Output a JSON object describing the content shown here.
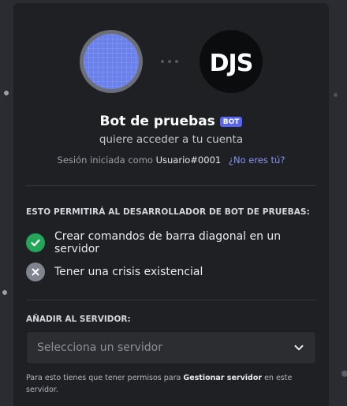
{
  "bot": {
    "name": "Bot de pruebas",
    "tag": "BOT",
    "avatar_text": "DJS"
  },
  "request": {
    "subtitle": "quiere acceder a tu cuenta"
  },
  "session": {
    "prefix": "Sesión iniciada como",
    "username": "Usuario#0001",
    "not_you_link": "¿No eres tú?"
  },
  "permissions": {
    "heading": "ESTO PERMITIRÁ AL DESARROLLADOR DE BOT DE PRUEBAS:",
    "items": [
      {
        "label": "Crear comandos de barra diagonal en un servidor",
        "status": "granted",
        "icon": "check-icon"
      },
      {
        "label": "Tener una crisis existencial",
        "status": "denied",
        "icon": "x-icon"
      }
    ]
  },
  "server": {
    "heading": "AÑADIR AL SERVIDOR:",
    "placeholder": "Selecciona un servidor",
    "hint_prefix": "Para esto tienes que tener permisos para",
    "hint_permission": "Gestionar servidor",
    "hint_suffix": "en este servidor."
  },
  "colors": {
    "modal_bg": "#1f2024",
    "accent": "#5865f2",
    "link": "#8a93f5",
    "granted": "#23a55a",
    "denied": "#80848e"
  }
}
